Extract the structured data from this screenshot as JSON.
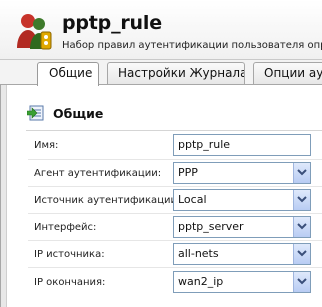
{
  "header": {
    "title": "pptp_rule",
    "subtitle": "Набор правил аутентификации пользователя определяет"
  },
  "tabs": [
    {
      "label": "Общие",
      "active": true
    },
    {
      "label": "Настройки Журнала",
      "active": false
    },
    {
      "label": "Опции аут",
      "active": false
    }
  ],
  "section": {
    "title": "Общие",
    "icon": "general-settings-icon"
  },
  "form": {
    "name": {
      "label": "Имя:",
      "value": "pptp_rule"
    },
    "auth_agent": {
      "label": "Агент аутентификации:",
      "value": "PPP"
    },
    "auth_source": {
      "label": "Источник аутентификации:",
      "value": "Local"
    },
    "interface": {
      "label": "Интерфейс:",
      "value": "pptp_server"
    },
    "source_ip": {
      "label": "IP источника:",
      "value": "all-nets"
    },
    "terminator_ip": {
      "label": "IP окончания:",
      "value": "wan2_ip"
    }
  },
  "colors": {
    "field_border": "#7f9db9",
    "select_button": "#c5d6f6",
    "arrow": "#3a4f7a"
  }
}
